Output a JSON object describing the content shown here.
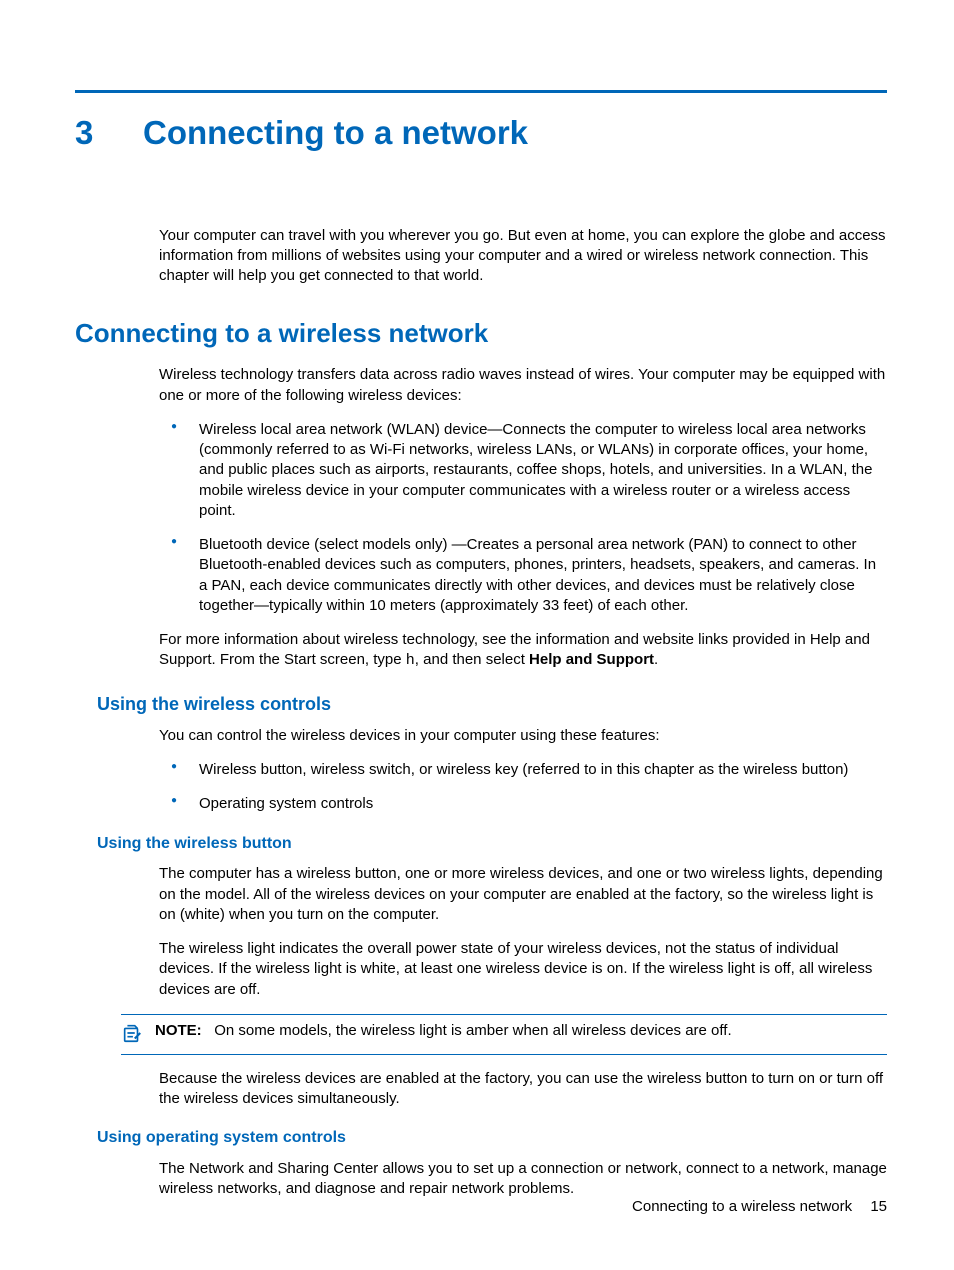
{
  "chapter": {
    "number": "3",
    "title": "Connecting to a network"
  },
  "intro": "Your computer can travel with you wherever you go. But even at home, you can explore the globe and access information from millions of websites using your computer and a wired or wireless network connection. This chapter will help you get connected to that world.",
  "section1": {
    "heading": "Connecting to a wireless network",
    "para1": "Wireless technology transfers data across radio waves instead of wires. Your computer may be equipped with one or more of the following wireless devices:",
    "bullets": [
      "Wireless local area network (WLAN) device—Connects the computer to wireless local area networks (commonly referred to as Wi-Fi networks, wireless LANs, or WLANs) in corporate offices, your home, and public places such as airports, restaurants, coffee shops, hotels, and universities. In a WLAN, the mobile wireless device in your computer communicates with a wireless router or a wireless access point.",
      "Bluetooth device (select models only) —Creates a personal area network (PAN) to connect to other Bluetooth-enabled devices such as computers, phones, printers, headsets, speakers, and cameras. In a PAN, each device communicates directly with other devices, and devices must be relatively close together—typically within 10 meters (approximately 33 feet) of each other."
    ],
    "para2_pre": "For more information about wireless technology, see the information and website links provided in Help and Support. From the Start screen, type ",
    "para2_code": "h",
    "para2_mid": ", and then select ",
    "para2_bold": "Help and Support",
    "para2_post": "."
  },
  "section2": {
    "heading": "Using the wireless controls",
    "para1": "You can control the wireless devices in your computer using these features:",
    "bullets": [
      "Wireless button, wireless switch, or wireless key (referred to in this chapter as the wireless button)",
      "Operating system controls"
    ]
  },
  "section3": {
    "heading": "Using the wireless button",
    "para1": "The computer has a wireless button, one or more wireless devices, and one or two wireless lights, depending on the model. All of the wireless devices on your computer are enabled at the factory, so the wireless light is on (white) when you turn on the computer.",
    "para2": "The wireless light indicates the overall power state of your wireless devices, not the status of individual devices. If the wireless light is white, at least one wireless device is on. If the wireless light is off, all wireless devices are off.",
    "note_label": "NOTE:",
    "note_text": "On some models, the wireless light is amber when all wireless devices are off.",
    "para3": "Because the wireless devices are enabled at the factory, you can use the wireless button to turn on or turn off the wireless devices simultaneously."
  },
  "section4": {
    "heading": "Using operating system controls",
    "para1": "The Network and Sharing Center allows you to set up a connection or network, connect to a network, manage wireless networks, and diagnose and repair network problems."
  },
  "footer": {
    "text": "Connecting to a wireless network",
    "page": "15"
  }
}
